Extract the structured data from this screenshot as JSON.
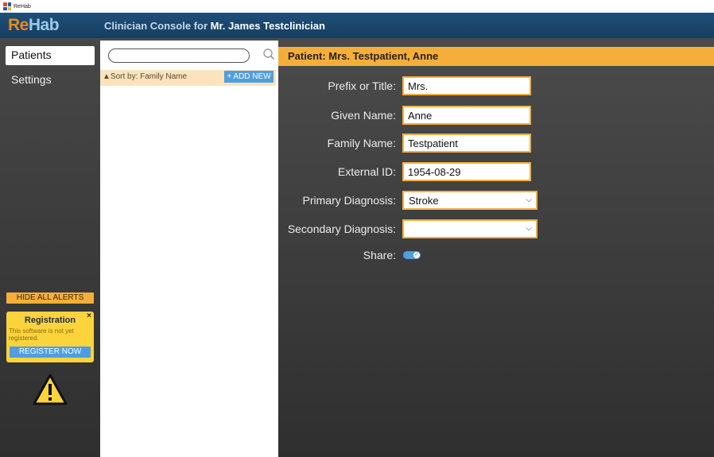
{
  "window": {
    "title": "ReHab"
  },
  "header": {
    "logo_re": "Re",
    "logo_hab": "Hab",
    "console_prefix": "Clinician Console for ",
    "clinician_name": "Mr. James Testclinician"
  },
  "nav": {
    "items": [
      {
        "label": "Patients",
        "active": true
      },
      {
        "label": "Settings",
        "active": false
      }
    ],
    "hide_alerts_label": "HIDE ALL ALERTS",
    "registration": {
      "close": "×",
      "title": "Registration",
      "text": "This software is not yet registered.",
      "button": "REGISTER NOW"
    }
  },
  "patient_list": {
    "search_value": "",
    "sort_label": "▲Sort by: Family Name",
    "add_new_label": "+ ADD NEW"
  },
  "patient_form": {
    "header": "Patient: Mrs. Testpatient, Anne",
    "fields": {
      "prefix": {
        "label": "Prefix or Title:",
        "value": "Mrs."
      },
      "given": {
        "label": "Given Name:",
        "value": "Anne"
      },
      "family": {
        "label": "Family Name:",
        "value": "Testpatient"
      },
      "external_id": {
        "label": "External ID:",
        "value": "1954-08-29"
      },
      "primary_dx": {
        "label": "Primary Diagnosis:",
        "value": "Stroke"
      },
      "secondary_dx": {
        "label": "Secondary Diagnosis:",
        "value": ""
      },
      "share": {
        "label": "Share:",
        "on": true
      }
    }
  },
  "colors": {
    "accent_orange": "#f6ae3b",
    "button_blue": "#4f9ee0",
    "header_navy": "#1f4f78",
    "alert_yellow": "#fbd43c"
  }
}
